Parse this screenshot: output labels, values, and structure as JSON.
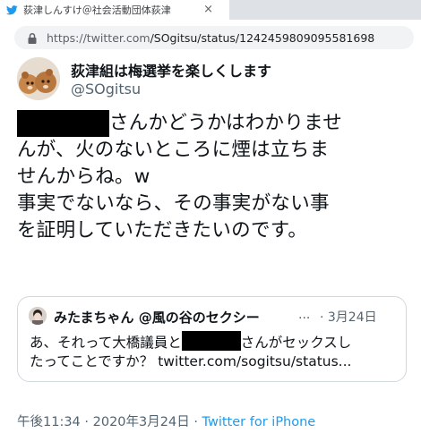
{
  "browser": {
    "tab_title": "荻津しんすけ＠社会活動団体荻津",
    "tab_close": "×",
    "url_host": "https://twitter.com",
    "url_path": "/SOgitsu/status/1242459809095581698"
  },
  "tweet": {
    "display_name": "荻津組は梅選挙を楽しくします",
    "handle": "@SOgitsu",
    "body_line1_after_redaction": "さんかどうかはわかりませ",
    "body_line2": "んが、火のないところに煙は立ちま",
    "body_line3": "せんからね。w",
    "body_line4": "事実でないなら、その事実がない事",
    "body_line5": "を証明していただきたいのです。",
    "time": "午後11:34",
    "separator": "·",
    "date": "2020年3月24日",
    "source": "Twitter for iPhone"
  },
  "quote": {
    "name": "みたまちゃん @風の谷のセクシー",
    "more": "...",
    "date": "· 3月24日",
    "line1_before_redaction": "あ、それって大橋議員と",
    "line1_after_redaction": "さんがセックスし",
    "line2": "たってことですか？ twitter.com/sogitsu/status..."
  },
  "colors": {
    "text": "#0f1419",
    "secondary": "#536471",
    "link": "#1d9bf0",
    "border": "#cfd9de",
    "redaction": "#000000"
  }
}
